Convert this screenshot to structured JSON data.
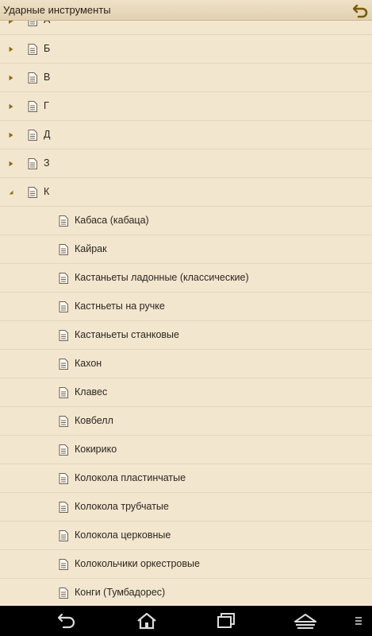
{
  "app": {
    "title": "Ударные инструменты"
  },
  "list": {
    "partial_label": "А",
    "groups": [
      {
        "label": "Б",
        "expanded": false
      },
      {
        "label": "В",
        "expanded": false
      },
      {
        "label": "Г",
        "expanded": false
      },
      {
        "label": "Д",
        "expanded": false
      },
      {
        "label": "З",
        "expanded": false
      },
      {
        "label": "К",
        "expanded": true
      }
    ],
    "items": [
      "Кабаса (кабаца)",
      "Кайрак",
      "Кастаньеты ладонные (классические)",
      "Кастньеты на ручке",
      "Кастаньеты станковые",
      "Кахон",
      "Клавес",
      "Ковбелл",
      "Кокирико",
      "Колокола пластинчатые",
      "Колокола трубчатые",
      "Колокола церковные",
      "Колокольчики оркестровые",
      "Конги (Тумбадорес)"
    ]
  },
  "colors": {
    "background": "#f3e6cf",
    "accent": "#8a6a14",
    "text": "#2b2620"
  },
  "icons": {
    "toolbar_back": "back-arrow-icon",
    "group_collapsed": "triangle-right-icon",
    "group_expanded": "triangle-down-icon",
    "document": "document-icon",
    "nav_back": "nav-back-icon",
    "nav_home": "home-icon",
    "nav_recent": "recent-apps-icon",
    "nav_hide": "hide-keyboard-icon",
    "nav_menu": "menu-icon"
  }
}
